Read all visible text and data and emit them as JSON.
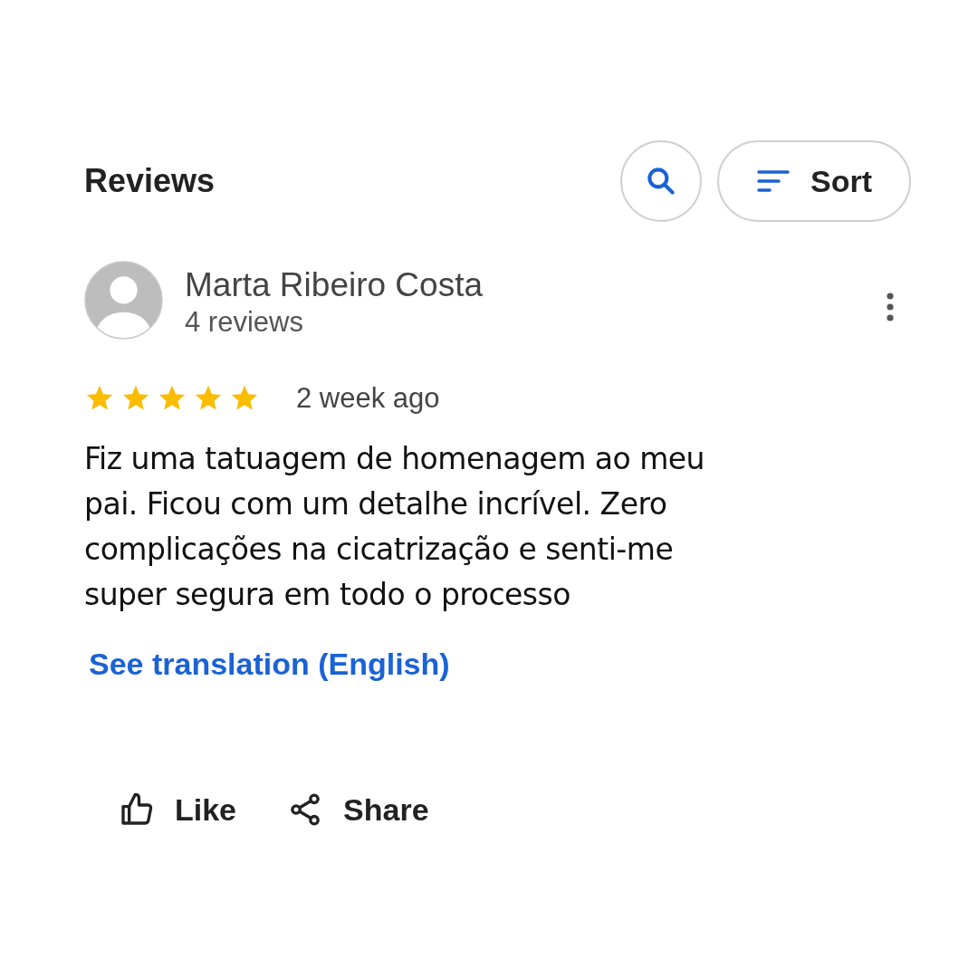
{
  "header": {
    "title": "Reviews",
    "sort_label": "Sort"
  },
  "review": {
    "author": "Marta Ribeiro Costa",
    "review_count": "4 reviews",
    "stars": 5,
    "time": "2 week ago",
    "text": "Fiz uma tatuagem de homenagem ao meu pai. Ficou com um detalhe incrível. Zero complicações na cicatrização e senti-me super segura em todo o processo",
    "translation_link": "See translation (English)"
  },
  "actions": [
    {
      "kind": "like",
      "label": "Like"
    },
    {
      "kind": "share",
      "label": "Share"
    }
  ]
}
